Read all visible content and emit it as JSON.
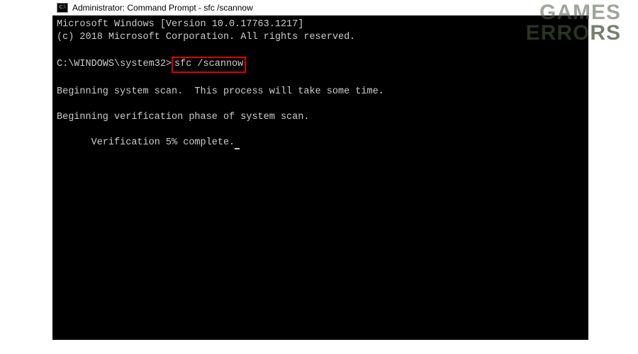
{
  "titlebar": {
    "text": "Administrator: Command Prompt - sfc  /scannow"
  },
  "terminal": {
    "line_version": "Microsoft Windows [Version 10.0.17763.1217]",
    "line_copyright": "(c) 2018 Microsoft Corporation. All rights reserved.",
    "prompt_path": "C:\\WINDOWS\\system32>",
    "command": "sfc /scannow",
    "line_begin_scan": "Beginning system scan.  This process will take some time.",
    "line_verify_phase": "Beginning verification phase of system scan.",
    "line_verify_progress": "Verification 5% complete."
  },
  "watermark": {
    "line1": "GAMES",
    "line2": "ERRORS"
  }
}
